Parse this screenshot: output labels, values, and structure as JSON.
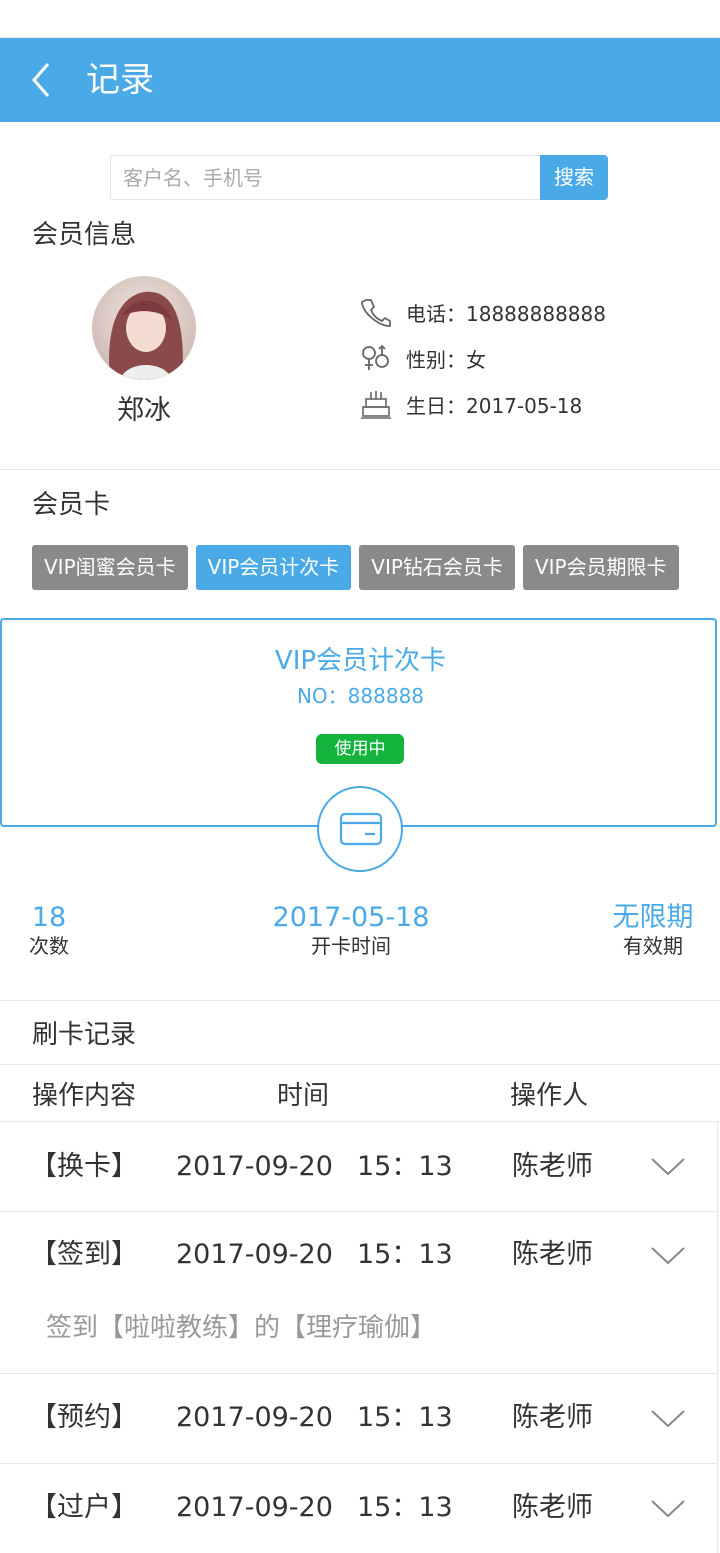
{
  "header": {
    "title": "记录"
  },
  "search": {
    "placeholder": "客户名、手机号",
    "button_label": "搜索"
  },
  "member": {
    "section_title": "会员信息",
    "name": "郑冰",
    "phone": "电话：18888888888",
    "gender": "性别：女",
    "birthday": "生日：2017-05-18"
  },
  "cards": {
    "section_title": "会员卡",
    "tabs": [
      {
        "label": "VIP闺蜜会员卡",
        "active": false
      },
      {
        "label": "VIP会员计次卡",
        "active": true
      },
      {
        "label": "VIP钻石会员卡",
        "active": false
      },
      {
        "label": "VIP会员期限卡",
        "active": false
      }
    ],
    "selected": {
      "name": "VIP会员计次卡",
      "number": "NO：888888",
      "status": "使用中"
    },
    "stats": [
      {
        "value": "18",
        "label": "次数"
      },
      {
        "value": "2017-05-18",
        "label": "开卡时间"
      },
      {
        "value": "无限期",
        "label": "有效期"
      }
    ]
  },
  "records": {
    "section_title": "刷卡记录",
    "columns": [
      "操作内容",
      "时间",
      "操作人"
    ],
    "rows": [
      {
        "type": "【换卡】",
        "date": "2017-09-20",
        "time": "15：13",
        "operator": "陈老师",
        "detail": ""
      },
      {
        "type": "【签到】",
        "date": "2017-09-20",
        "time": "15：13",
        "operator": "陈老师",
        "detail": "签到【啦啦教练】的【理疗瑜伽】"
      },
      {
        "type": "【预约】",
        "date": "2017-09-20",
        "time": "15：13",
        "operator": "陈老师",
        "detail": ""
      },
      {
        "type": "【过户】",
        "date": "2017-09-20",
        "time": "15：13",
        "operator": "陈老师",
        "detail": ""
      }
    ]
  },
  "colors": {
    "accent": "#4aaae8",
    "status_green": "#14b43c",
    "tab_inactive": "#8a8a8a"
  }
}
